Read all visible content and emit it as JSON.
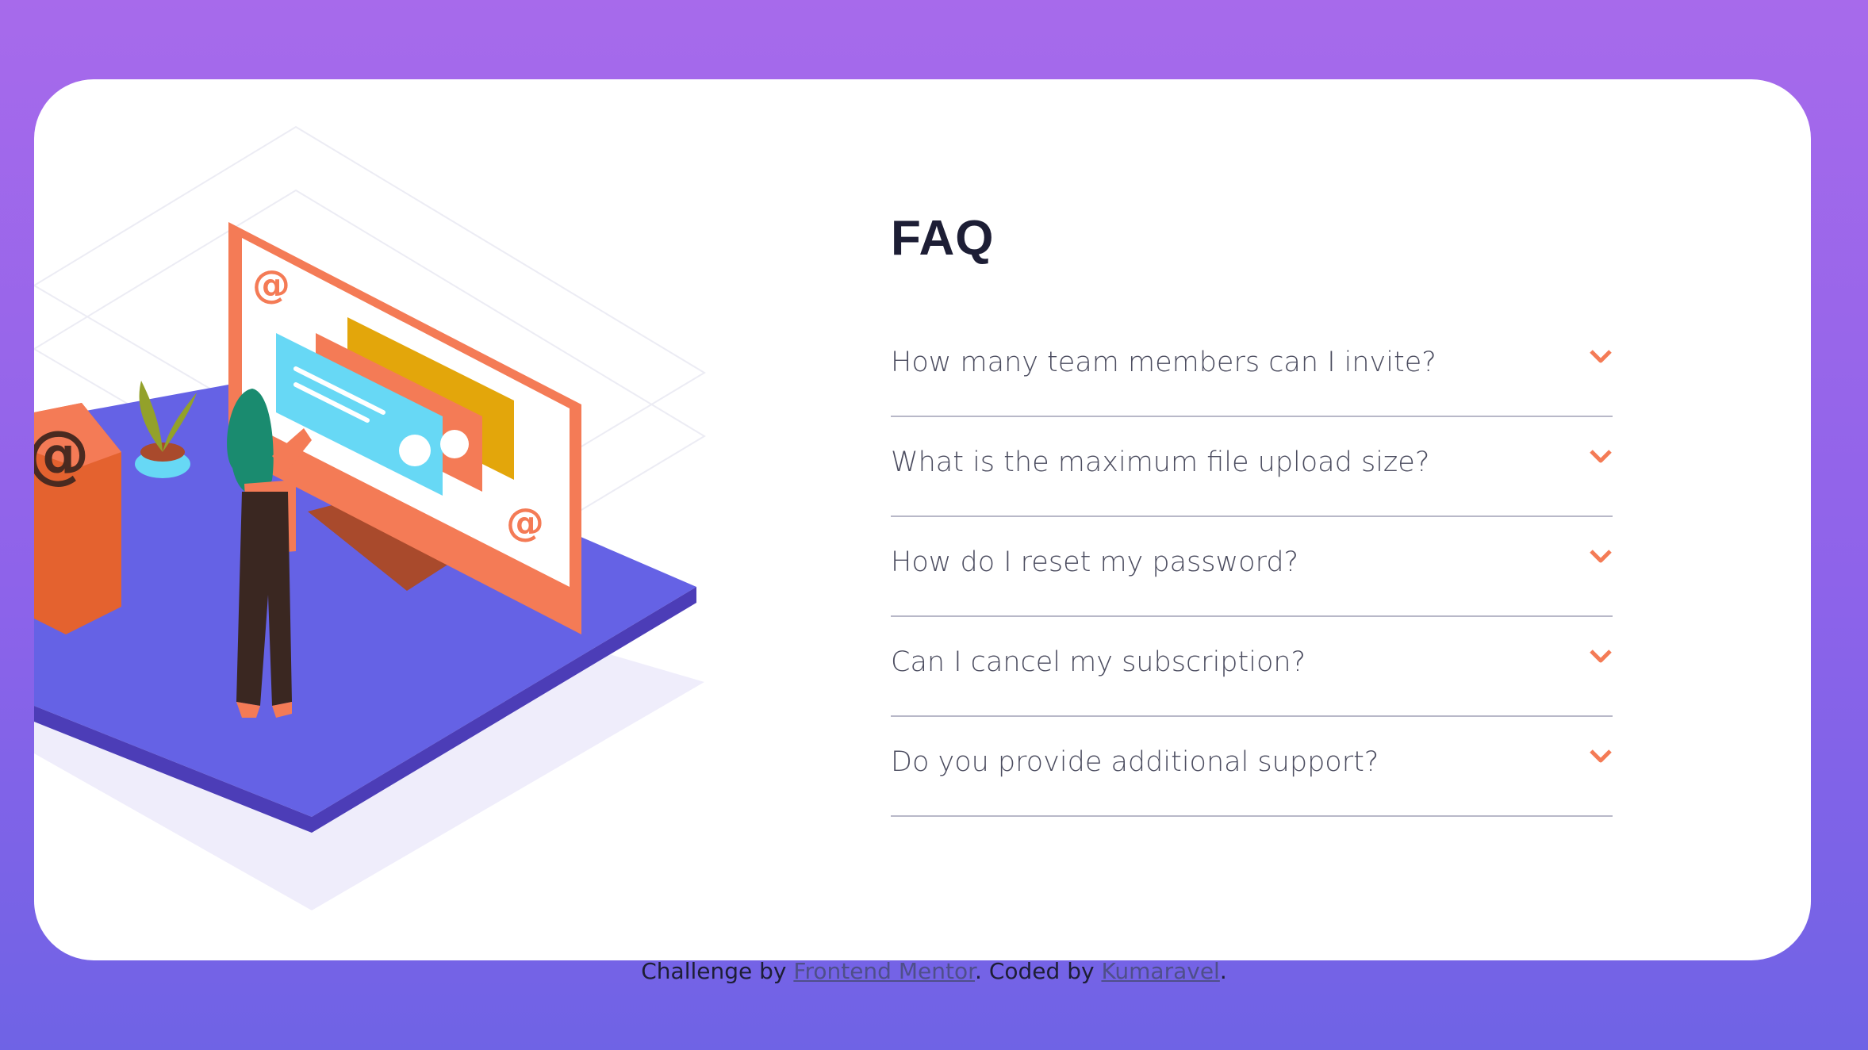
{
  "faq": {
    "title": "FAQ",
    "items": [
      {
        "question": "How many team members can I invite?",
        "icon": "chevron-down-icon"
      },
      {
        "question": "What is the maximum file upload size?",
        "icon": "chevron-down-icon"
      },
      {
        "question": "How do I reset my password?",
        "icon": "chevron-down-icon"
      },
      {
        "question": "Can I cancel my subscription?",
        "icon": "chevron-down-icon"
      },
      {
        "question": "Do you provide additional support?",
        "icon": "chevron-down-icon"
      }
    ]
  },
  "footer": {
    "prefix": "Challenge by ",
    "link1": "Frontend Mentor",
    "middle": ". Coded by ",
    "link2": "Kumaravel",
    "suffix": "."
  },
  "colors": {
    "accent": "#f47b56",
    "title": "#1d1e35",
    "question": "#4b4c5f",
    "background_top": "#a76aeb",
    "background_bottom": "#6f63e5"
  }
}
